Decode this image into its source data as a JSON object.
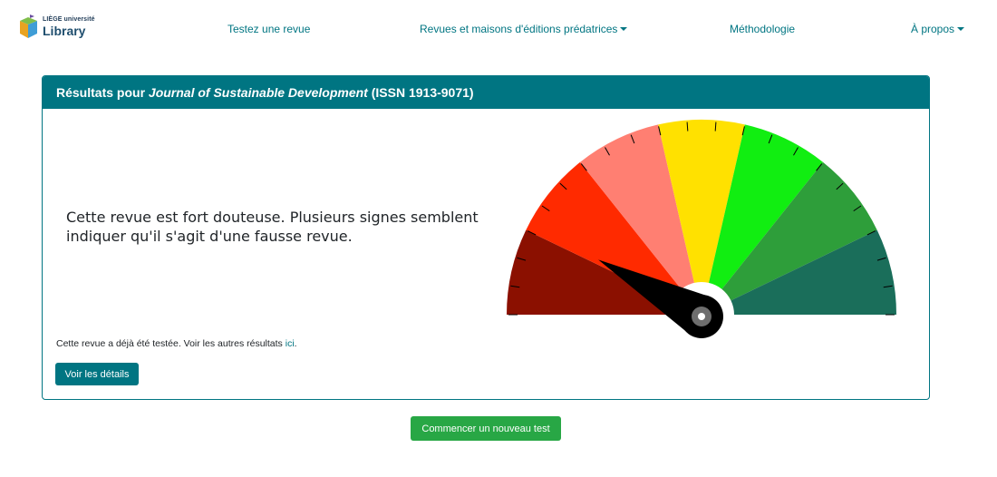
{
  "brand": {
    "university": "LIÈGE université",
    "library": "Library"
  },
  "nav": {
    "test_journal": "Testez une revue",
    "predatory": "Revues et maisons d'éditions prédatrices",
    "methodology": "Méthodologie",
    "about": "À propos"
  },
  "result": {
    "header_prefix": "Résultats pour ",
    "journal_title": "Journal of Sustainable Development",
    "issn": " (ISSN 1913-9071)",
    "verdict": "Cette revue est fort douteuse. Plusieurs signes semblent indiquer qu'il s'agit d'une fausse revue.",
    "history_text": "Cette revue a déjà été testée. Voir les autres résultats ",
    "history_link": "ici",
    "history_end": ".",
    "details_button": "Voir les détails"
  },
  "gauge": {
    "segment_colors": [
      "#8b1000",
      "#ff2a00",
      "#ff7f72",
      "#ffe100",
      "#11ee11",
      "#2e9e3a",
      "#1a6e5a"
    ],
    "needle_color": "#000000",
    "level": 0.16
  },
  "actions": {
    "new_test_button": "Commencer un nouveau test"
  }
}
